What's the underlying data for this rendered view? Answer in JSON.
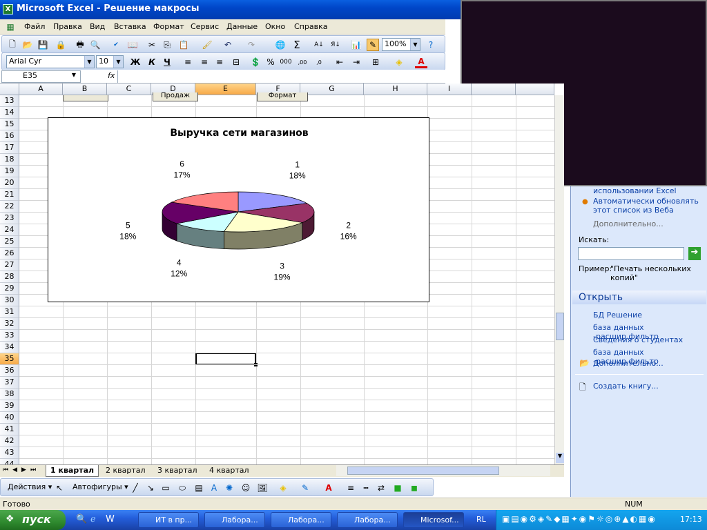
{
  "window": {
    "title": "Microsoft Excel - Решение макросы",
    "icon": "excel-icon"
  },
  "menu": [
    "Файл",
    "Правка",
    "Вид",
    "Вставка",
    "Формат",
    "Сервис",
    "Данные",
    "Окно",
    "Справка"
  ],
  "toolbar": {
    "zoom": "100%",
    "font": "Arial Cyr",
    "font_size": "10",
    "bold": "Ж",
    "italic": "К",
    "underline": "Ч",
    "sigma": "Σ",
    "percent": "%",
    "thousands": "000"
  },
  "formula_bar": {
    "name_box": "E35",
    "fx": "fx",
    "value": ""
  },
  "columns": [
    "A",
    "B",
    "C",
    "D",
    "E",
    "F",
    "G",
    "H",
    "I"
  ],
  "rows": [
    "13",
    "14",
    "15",
    "16",
    "17",
    "18",
    "19",
    "20",
    "21",
    "22",
    "23",
    "24",
    "25",
    "26",
    "27",
    "28",
    "29",
    "30",
    "31",
    "32",
    "33",
    "34",
    "35",
    "36",
    "37",
    "38",
    "39",
    "40",
    "41",
    "42",
    "43",
    "44"
  ],
  "buttons": {
    "btn_d_label": "Продаж",
    "btn_f_label": "Формат"
  },
  "active_cell": "E35",
  "chart_data": {
    "type": "pie",
    "title": "Выручка сети магазинов",
    "categories": [
      "1",
      "2",
      "3",
      "4",
      "5",
      "6"
    ],
    "values": [
      18,
      16,
      19,
      12,
      18,
      17
    ],
    "labels": [
      "1\n18%",
      "2\n16%",
      "3\n19%",
      "4\n12%",
      "5\n18%",
      "6\n17%"
    ],
    "colors": [
      "#9999ff",
      "#993366",
      "#ffffcc",
      "#ccffff",
      "#660066",
      "#ff8080"
    ],
    "legend": "none",
    "style": "3d"
  },
  "sheet_tabs": [
    "1 квартал",
    "2 квартал",
    "3 квартал",
    "4 квартал"
  ],
  "draw_toolbar": {
    "actions": "Действия",
    "autoshapes": "Автофигуры"
  },
  "status": {
    "left": "Готово",
    "num": "NUM"
  },
  "task_pane": {
    "update_text_1": "использовании Excel",
    "update_link": "Автоматически обновлять этот список из Веба",
    "more_1": "Дополнительно...",
    "search_label": "Искать:",
    "search_value": "",
    "example_label": "Пример:",
    "example_text": "\"Печать нескольких копий\"",
    "open_header": "Открыть",
    "files": [
      "БД Решение",
      "база данных -расшир.фильтр",
      "Сведения о студентах",
      "база данных -расшир.фильтр"
    ],
    "more_2": "Дополнительно...",
    "new_book": "Создать книгу..."
  },
  "taskbar": {
    "start": "пуск",
    "tasks": [
      "ИТ в пр...",
      "Лабора...",
      "Лабора...",
      "Лабора...",
      "Microsof..."
    ],
    "lang": "RL",
    "clock": "17:13"
  }
}
